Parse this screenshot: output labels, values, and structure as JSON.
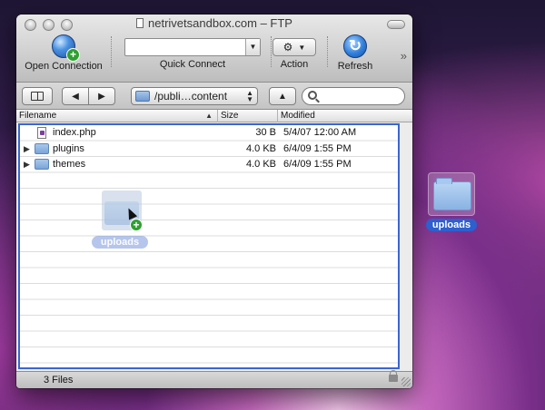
{
  "window": {
    "title": "netrivetsandbox.com – FTP"
  },
  "toolbar": {
    "open_connection": "Open Connection",
    "quick_connect": "Quick Connect",
    "quick_connect_value": "",
    "action": "Action",
    "refresh": "Refresh"
  },
  "navbar": {
    "back": "◀",
    "forward": "▶",
    "path": "/publi…content",
    "up": "▲",
    "search_value": ""
  },
  "columns": {
    "filename": "Filename",
    "size": "Size",
    "modified": "Modified"
  },
  "files": [
    {
      "name": "index.php",
      "size": "30 B",
      "modified": "5/4/07 12:00 AM",
      "type": "file",
      "icon": "php-file-icon"
    },
    {
      "name": "plugins",
      "size": "4.0 KB",
      "modified": "6/4/09 1:55 PM",
      "type": "folder",
      "icon": "folder-icon"
    },
    {
      "name": "themes",
      "size": "4.0 KB",
      "modified": "6/4/09 1:55 PM",
      "type": "folder",
      "icon": "folder-icon"
    }
  ],
  "drag": {
    "label": "uploads"
  },
  "status": {
    "count": "3 Files"
  },
  "desktop": {
    "folder_label": "uploads"
  },
  "colors": {
    "selection_border": "#3a66d4",
    "desktop_label": "#2d5fcf",
    "add_badge": "#2ea02e"
  }
}
